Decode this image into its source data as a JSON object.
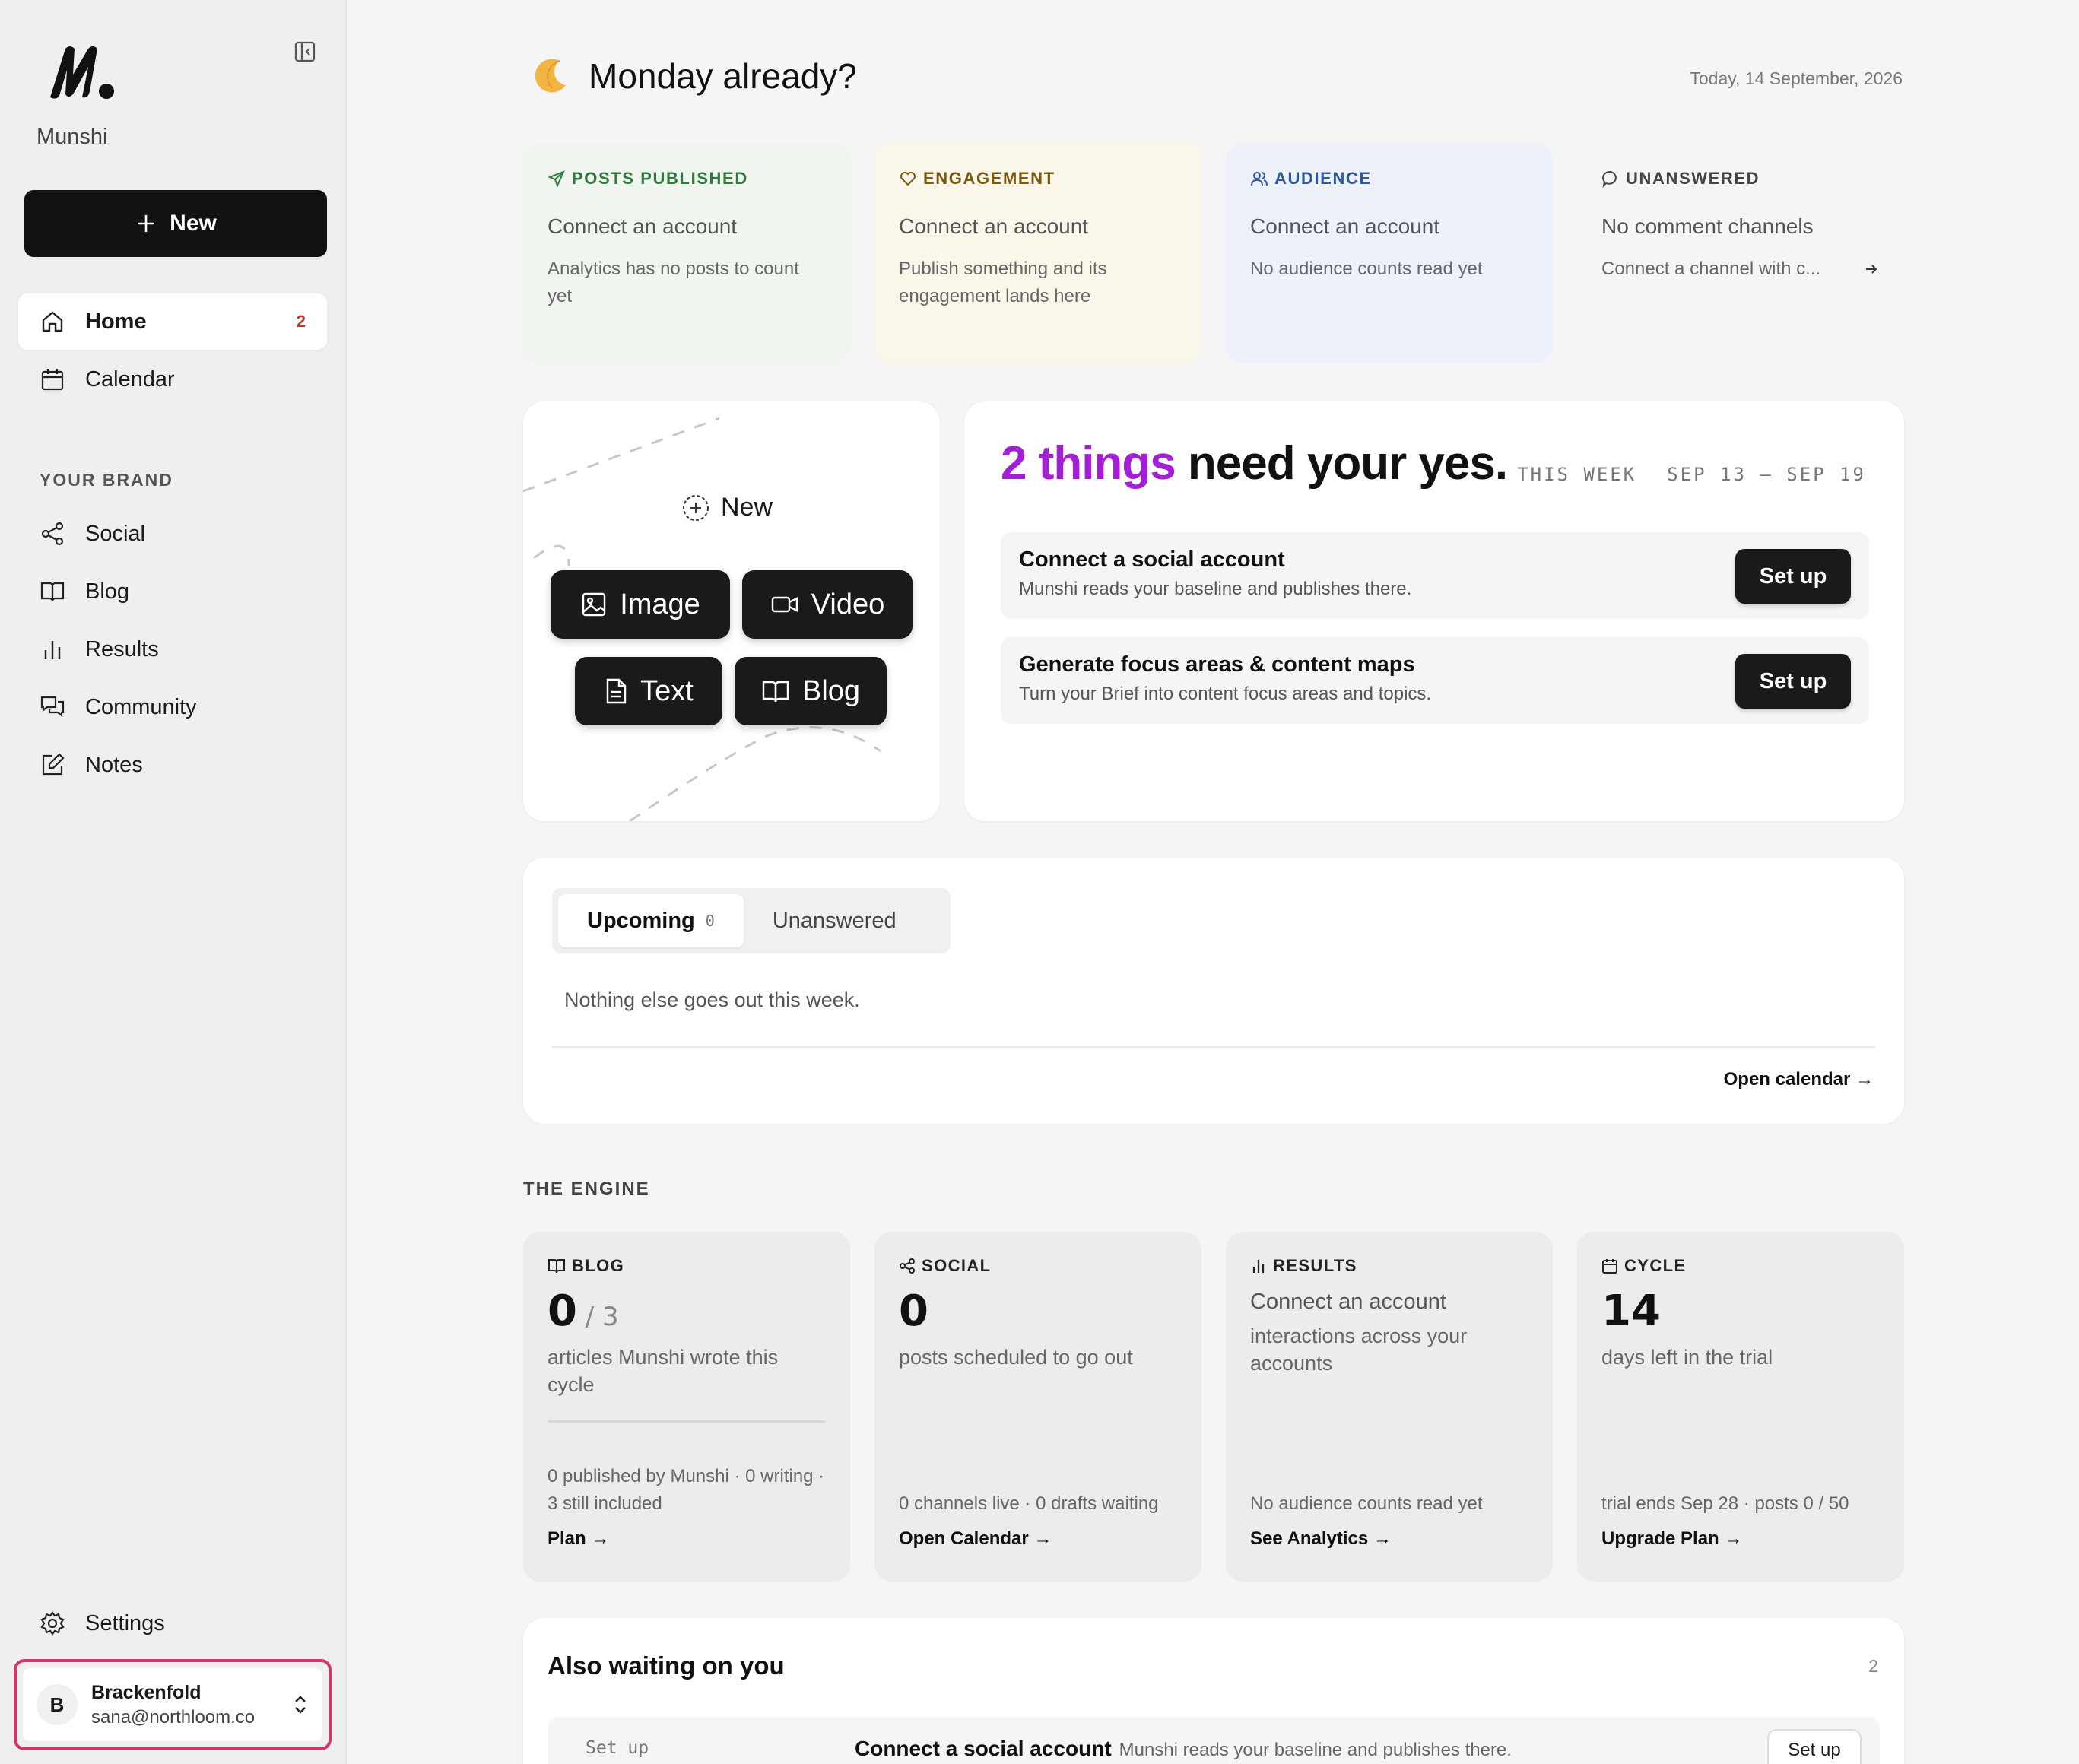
{
  "app": {
    "brand": "Munshi"
  },
  "sidebar": {
    "new_label": "New",
    "nav": [
      {
        "label": "Home",
        "badge": "2"
      },
      {
        "label": "Calendar"
      }
    ],
    "section_label": "YOUR BRAND",
    "brand_items": [
      {
        "label": "Social"
      },
      {
        "label": "Blog"
      },
      {
        "label": "Results"
      },
      {
        "label": "Community"
      },
      {
        "label": "Notes"
      }
    ],
    "settings_label": "Settings",
    "account": {
      "initial": "B",
      "name": "Brackenfold",
      "email": "sana@northloom.co"
    }
  },
  "header": {
    "greeting": "Monday already?",
    "date": "Today, 14 September, 2026"
  },
  "stats": [
    {
      "label": "POSTS PUBLISHED",
      "title": "Connect an account",
      "desc": "Analytics has no posts to count yet",
      "color": "#2f7a3d",
      "bg": "#f0f5ef"
    },
    {
      "label": "ENGAGEMENT",
      "title": "Connect an account",
      "desc": "Publish something and its engagement lands here",
      "color": "#7a5a0f",
      "bg": "#faf6ea"
    },
    {
      "label": "AUDIENCE",
      "title": "Connect an account",
      "desc": "No audience counts read yet",
      "color": "#2d5a9a",
      "bg": "#edf2fa"
    },
    {
      "label": "UNANSWERED",
      "title": "No comment channels",
      "desc": "Connect a channel with c...",
      "color": "#444444",
      "bg": "#f5f5f5"
    }
  ],
  "create": {
    "new_label": "New",
    "buttons": {
      "image": "Image",
      "video": "Video",
      "text": "Text",
      "blog": "Blog"
    }
  },
  "approvals": {
    "title_highlight": "2 things",
    "title_rest": " need your yes.",
    "week_label": "THIS WEEK",
    "week_range": "SEP 13 – SEP 19",
    "tasks": [
      {
        "title": "Connect a social account",
        "desc": "Munshi reads your baseline and publishes there.",
        "button": "Set up"
      },
      {
        "title": "Generate focus areas & content maps",
        "desc": "Turn your Brief into content focus areas and topics.",
        "button": "Set up"
      }
    ]
  },
  "upcoming": {
    "tabs": [
      {
        "label": "Upcoming",
        "count": "0"
      },
      {
        "label": "Unanswered"
      }
    ],
    "empty": "Nothing else goes out this week.",
    "link": "Open calendar →"
  },
  "engine": {
    "label": "THE ENGINE",
    "cards": [
      {
        "label": "BLOG",
        "big": "0",
        "big_sub": " / 3",
        "desc": "articles Munshi wrote this cycle",
        "foot": "0 published by Munshi · 0 writing · 3 still included",
        "link": "Plan →",
        "progress": 0
      },
      {
        "label": "SOCIAL",
        "big": "0",
        "desc": "posts scheduled to go out",
        "foot": "0 channels live · 0 drafts waiting",
        "link": "Open Calendar →"
      },
      {
        "label": "RESULTS",
        "title": "Connect an account",
        "desc": "interactions across your accounts",
        "foot": "No audience counts read yet",
        "link": "See Analytics →"
      },
      {
        "label": "CYCLE",
        "big": "14",
        "desc": "days left in the trial",
        "foot": "trial ends Sep 28 · posts 0 / 50",
        "link": "Upgrade Plan →"
      }
    ]
  },
  "waiting": {
    "title": "Also waiting on you",
    "count": "2",
    "row": {
      "tag": "Set up",
      "title": "Connect a social account",
      "desc": "Munshi reads your baseline and publishes there.",
      "button": "Set up"
    }
  },
  "colors": {
    "accent_purple": "#a21fd6",
    "highlight_border": "#d6336c",
    "badge_red": "#c0392b"
  }
}
